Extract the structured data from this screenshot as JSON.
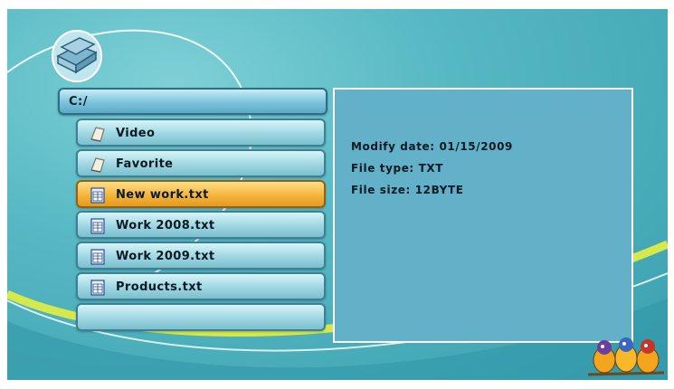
{
  "path": "C:/",
  "files": [
    {
      "label": "Video",
      "icon": "folder-note-icon",
      "selected": false
    },
    {
      "label": "Favorite",
      "icon": "folder-note-icon",
      "selected": false
    },
    {
      "label": "New work.txt",
      "icon": "text-file-icon",
      "selected": true
    },
    {
      "label": "Work 2008.txt",
      "icon": "text-file-icon",
      "selected": false
    },
    {
      "label": "Work 2009.txt",
      "icon": "text-file-icon",
      "selected": false
    },
    {
      "label": "Products.txt",
      "icon": "text-file-icon",
      "selected": false
    },
    {
      "label": "",
      "icon": "",
      "selected": false
    }
  ],
  "info": {
    "modify_date": "Modify date: 01/15/2009",
    "file_type": "File type: TXT",
    "file_size": "File size: 12BYTE"
  },
  "colors": {
    "background": "#4fb2bf",
    "selected_row": "#f4b53d",
    "row": "#9ed6e2",
    "info_panel": "#62b1c9",
    "accent_swoosh": "#d7e84a"
  }
}
